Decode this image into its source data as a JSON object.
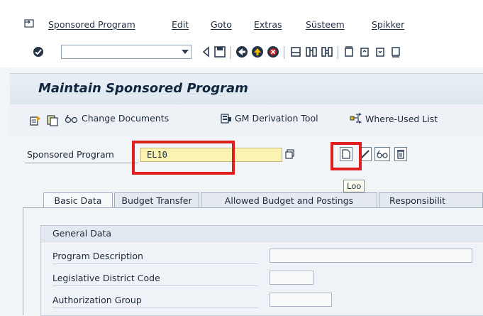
{
  "menu": {
    "items": [
      "Sponsored Program",
      "Edit",
      "Goto",
      "Extras",
      "Süsteem",
      "Spikker"
    ]
  },
  "toolbar": {
    "command_field_value": ""
  },
  "header": {
    "title": "Maintain Sponsored Program"
  },
  "appbar": {
    "change_documents": "Change Documents",
    "gm_derivation_tool": "GM Derivation Tool",
    "where_used_list": "Where-Used List"
  },
  "form": {
    "sponsored_program_label": "Sponsored Program",
    "sponsored_program_value": "EL10",
    "tooltip": "Loo"
  },
  "tabs": [
    "Basic Data",
    "Budget Transfer",
    "Allowed Budget and Postings",
    "Responsibilit"
  ],
  "general_data": {
    "title": "General Data",
    "fields": [
      "Program Description",
      "Legislative District Code",
      "Authorization Group"
    ]
  },
  "colors": {
    "highlight_red": "#e02020",
    "required_field_yellow": "#fbf3b2"
  }
}
